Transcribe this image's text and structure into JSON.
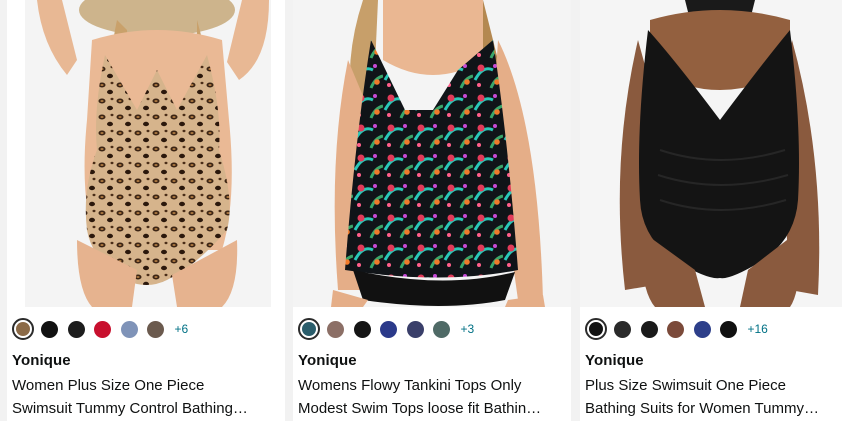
{
  "products": [
    {
      "image_alt": "Leopard print one piece swimsuit",
      "brand": "Yonique",
      "title_line1": "Women Plus Size One Piece",
      "title_line2": "Swimsuit Tummy Control Bathing…",
      "more_colors": "+6",
      "swatch_colors": [
        "#8b6a47",
        "#111111",
        "#1d1d1d",
        "#c8102e",
        "#7f93b8",
        "#6b5a4e"
      ]
    },
    {
      "image_alt": "Floral tropical print flowy tankini top",
      "brand": "Yonique",
      "title_line1": "Womens Flowy Tankini Tops Only",
      "title_line2": "Modest Swim Tops loose fit Bathin…",
      "more_colors": "+3",
      "swatch_colors": [
        "#2a5d6b",
        "#8c6f66",
        "#151515",
        "#2b3a8a",
        "#3a3f6a",
        "#4f6a66"
      ]
    },
    {
      "image_alt": "Black ruched one piece swimsuit",
      "brand": "Yonique",
      "title_line1": "Plus Size Swimsuit One Piece",
      "title_line2": "Bathing Suits for Women Tummy…",
      "more_colors": "+16",
      "swatch_colors": [
        "#111111",
        "#2a2a2a",
        "#1a1a1a",
        "#7b4a3a",
        "#2d3f8a",
        "#101010"
      ]
    }
  ]
}
